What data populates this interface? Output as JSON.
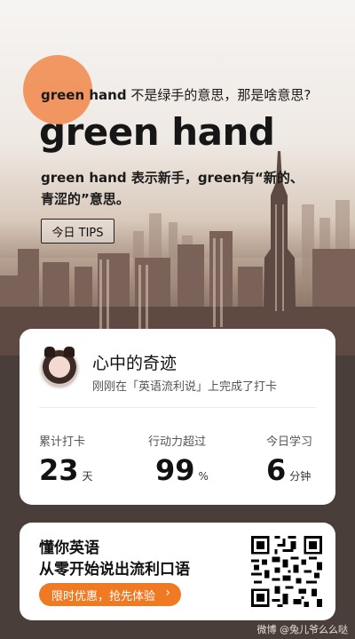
{
  "hero": {
    "subtitle_bold": "green hand",
    "subtitle_rest": " 不是绿手的意思，那是啥意思?",
    "title": "green hand",
    "desc": "green hand 表示新手，green有“新的、青涩的”意思。",
    "tips_label": "今日 TIPS"
  },
  "profile": {
    "name": "心中的奇迹",
    "checkin_text": "刚刚在「英语流利说」上完成了打卡"
  },
  "stats": [
    {
      "label": "累计打卡",
      "value": "23",
      "unit": "天"
    },
    {
      "label": "行动力超过",
      "value": "99",
      "unit": "%"
    },
    {
      "label": "今日学习",
      "value": "6",
      "unit": "分钟"
    }
  ],
  "promo": {
    "title": "懂你英语",
    "subtitle": "从零开始说出流利口语",
    "button_label": "限时优惠，抢先体验",
    "accent": "#f07a23"
  },
  "watermark": "微博 @兔儿爷么么哒"
}
